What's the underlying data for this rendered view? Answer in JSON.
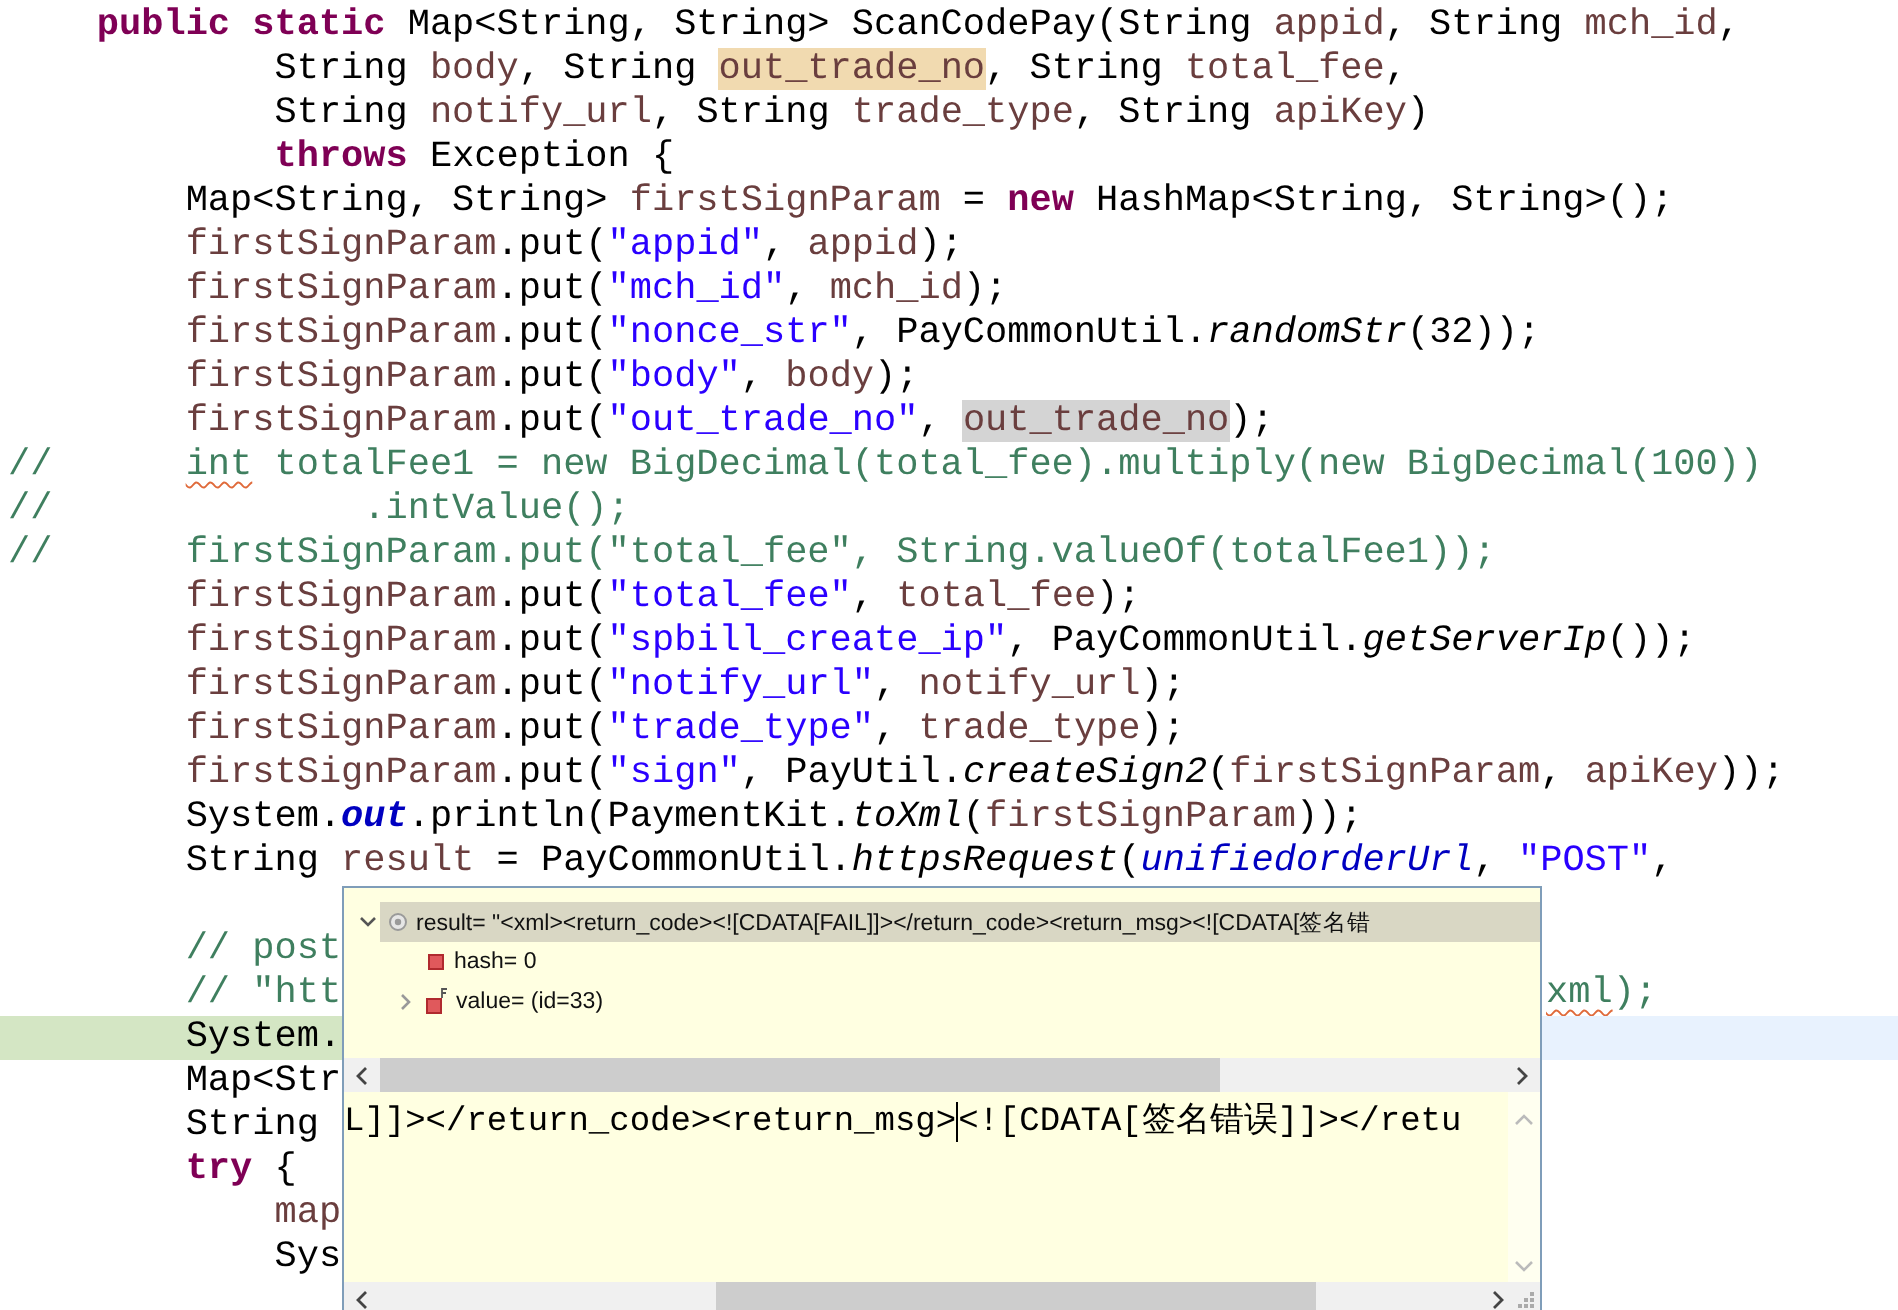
{
  "editor": {
    "lines": [
      {
        "tokens": [
          {
            "kind": "keyword",
            "t": "    public static"
          },
          {
            "kind": "plain",
            "t": " Map<String, String> ScanCodePay(String "
          },
          {
            "kind": "var",
            "t": "appid"
          },
          {
            "kind": "plain",
            "t": ", String "
          },
          {
            "kind": "var",
            "t": "mch_id"
          },
          {
            "kind": "plain",
            "t": ","
          }
        ]
      },
      {
        "tokens": [
          {
            "kind": "plain",
            "t": "            String "
          },
          {
            "kind": "var",
            "t": "body"
          },
          {
            "kind": "plain",
            "t": ", String "
          },
          {
            "kind": "var",
            "t": "out_trade_no",
            "write_occurrence": true
          },
          {
            "kind": "plain",
            "t": ", String "
          },
          {
            "kind": "var",
            "t": "total_fee"
          },
          {
            "kind": "plain",
            "t": ","
          }
        ]
      },
      {
        "tokens": [
          {
            "kind": "plain",
            "t": "            String "
          },
          {
            "kind": "var",
            "t": "notify_url"
          },
          {
            "kind": "plain",
            "t": ", String "
          },
          {
            "kind": "var",
            "t": "trade_type"
          },
          {
            "kind": "plain",
            "t": ", String "
          },
          {
            "kind": "var",
            "t": "apiKey"
          },
          {
            "kind": "plain",
            "t": ")"
          }
        ]
      },
      {
        "tokens": [
          {
            "kind": "keyword",
            "t": "            throws"
          },
          {
            "kind": "plain",
            "t": " Exception {"
          }
        ]
      },
      {
        "tokens": [
          {
            "kind": "plain",
            "t": "        Map<String, String> "
          },
          {
            "kind": "var",
            "t": "firstSignParam"
          },
          {
            "kind": "plain",
            "t": " = "
          },
          {
            "kind": "keyword",
            "t": "new"
          },
          {
            "kind": "plain",
            "t": " HashMap<String, String>();"
          }
        ]
      },
      {
        "tokens": [
          {
            "kind": "var",
            "t": "        firstSignParam"
          },
          {
            "kind": "plain",
            "t": ".put("
          },
          {
            "kind": "string",
            "t": "\"appid\""
          },
          {
            "kind": "plain",
            "t": ", "
          },
          {
            "kind": "var",
            "t": "appid"
          },
          {
            "kind": "plain",
            "t": ");"
          }
        ]
      },
      {
        "tokens": [
          {
            "kind": "var",
            "t": "        firstSignParam"
          },
          {
            "kind": "plain",
            "t": ".put("
          },
          {
            "kind": "string",
            "t": "\"mch_id\""
          },
          {
            "kind": "plain",
            "t": ", "
          },
          {
            "kind": "var",
            "t": "mch_id"
          },
          {
            "kind": "plain",
            "t": ");"
          }
        ]
      },
      {
        "tokens": [
          {
            "kind": "var",
            "t": "        firstSignParam"
          },
          {
            "kind": "plain",
            "t": ".put("
          },
          {
            "kind": "string",
            "t": "\"nonce_str\""
          },
          {
            "kind": "plain",
            "t": ", PayCommonUtil."
          },
          {
            "kind": "static_method",
            "t": "randomStr"
          },
          {
            "kind": "plain",
            "t": "(32));"
          }
        ]
      },
      {
        "tokens": [
          {
            "kind": "var",
            "t": "        firstSignParam"
          },
          {
            "kind": "plain",
            "t": ".put("
          },
          {
            "kind": "string",
            "t": "\"body\""
          },
          {
            "kind": "plain",
            "t": ", "
          },
          {
            "kind": "var",
            "t": "body"
          },
          {
            "kind": "plain",
            "t": ");"
          }
        ]
      },
      {
        "tokens": [
          {
            "kind": "var",
            "t": "        firstSignParam"
          },
          {
            "kind": "plain",
            "t": ".put("
          },
          {
            "kind": "string",
            "t": "\"out_trade_no\""
          },
          {
            "kind": "plain",
            "t": ", "
          },
          {
            "kind": "var",
            "t": "out_trade_no",
            "read_occurrence": true
          },
          {
            "kind": "plain",
            "t": ");"
          }
        ]
      },
      {
        "tokens": [
          {
            "kind": "comment",
            "t": "//      "
          },
          {
            "kind": "comment",
            "t": "int",
            "squiggle": true
          },
          {
            "kind": "comment",
            "t": " totalFee1 = new BigDecimal(total_fee).multiply(new BigDecimal(100))"
          }
        ]
      },
      {
        "tokens": [
          {
            "kind": "comment",
            "t": "//              .intValue();"
          }
        ]
      },
      {
        "tokens": [
          {
            "kind": "comment",
            "t": "//      firstSignParam.put(\"total_fee\", String.valueOf(totalFee1));"
          }
        ]
      },
      {
        "tokens": [
          {
            "kind": "var",
            "t": "        firstSignParam"
          },
          {
            "kind": "plain",
            "t": ".put("
          },
          {
            "kind": "string",
            "t": "\"total_fee\""
          },
          {
            "kind": "plain",
            "t": ", "
          },
          {
            "kind": "var",
            "t": "total_fee"
          },
          {
            "kind": "plain",
            "t": ");"
          }
        ]
      },
      {
        "tokens": [
          {
            "kind": "var",
            "t": "        firstSignParam"
          },
          {
            "kind": "plain",
            "t": ".put("
          },
          {
            "kind": "string",
            "t": "\"spbill_create_ip\""
          },
          {
            "kind": "plain",
            "t": ", PayCommonUtil."
          },
          {
            "kind": "static_method",
            "t": "getServerIp"
          },
          {
            "kind": "plain",
            "t": "());"
          }
        ]
      },
      {
        "tokens": [
          {
            "kind": "var",
            "t": "        firstSignParam"
          },
          {
            "kind": "plain",
            "t": ".put("
          },
          {
            "kind": "string",
            "t": "\"notify_url\""
          },
          {
            "kind": "plain",
            "t": ", "
          },
          {
            "kind": "var",
            "t": "notify_url"
          },
          {
            "kind": "plain",
            "t": ");"
          }
        ]
      },
      {
        "tokens": [
          {
            "kind": "var",
            "t": "        firstSignParam"
          },
          {
            "kind": "plain",
            "t": ".put("
          },
          {
            "kind": "string",
            "t": "\"trade_type\""
          },
          {
            "kind": "plain",
            "t": ", "
          },
          {
            "kind": "var",
            "t": "trade_type"
          },
          {
            "kind": "plain",
            "t": ");"
          }
        ]
      },
      {
        "tokens": [
          {
            "kind": "var",
            "t": "        firstSignParam"
          },
          {
            "kind": "plain",
            "t": ".put("
          },
          {
            "kind": "string",
            "t": "\"sign\""
          },
          {
            "kind": "plain",
            "t": ", PayUtil."
          },
          {
            "kind": "static_method",
            "t": "createSign2"
          },
          {
            "kind": "plain",
            "t": "("
          },
          {
            "kind": "var",
            "t": "firstSignParam"
          },
          {
            "kind": "plain",
            "t": ", "
          },
          {
            "kind": "var",
            "t": "apiKey"
          },
          {
            "kind": "plain",
            "t": "));"
          }
        ]
      },
      {
        "tokens": [
          {
            "kind": "plain",
            "t": "        System."
          },
          {
            "kind": "static_field",
            "t": "out"
          },
          {
            "kind": "plain",
            "t": ".println(PaymentKit."
          },
          {
            "kind": "static_method",
            "t": "toXml"
          },
          {
            "kind": "plain",
            "t": "("
          },
          {
            "kind": "var",
            "t": "firstSignParam"
          },
          {
            "kind": "plain",
            "t": "));"
          }
        ]
      },
      {
        "tokens": [
          {
            "kind": "plain",
            "t": "        String "
          },
          {
            "kind": "var",
            "t": "result"
          },
          {
            "kind": "plain",
            "t": " = PayCommonUtil."
          },
          {
            "kind": "static_method",
            "t": "httpsRequest"
          },
          {
            "kind": "plain",
            "t": "("
          },
          {
            "kind": "constant",
            "t": "unifiedorderUrl"
          },
          {
            "kind": "plain",
            "t": ", "
          },
          {
            "kind": "string",
            "t": "\"POST\""
          },
          {
            "kind": "plain",
            "t": ","
          }
        ]
      },
      {
        "current": false
      },
      {
        "tokens": [
          {
            "kind": "comment",
            "t": "        // post"
          }
        ]
      },
      {
        "tokens": [
          {
            "kind": "comment",
            "t": "        // \"htt"
          }
        ],
        "right": [
          {
            "kind": "comment",
            "t": "xml",
            "squiggle": true
          },
          {
            "kind": "comment",
            "t": ");"
          }
        ]
      },
      {
        "tokens": [
          {
            "kind": "plain",
            "t": "        System."
          }
        ],
        "current": true
      },
      {
        "tokens": [
          {
            "kind": "plain",
            "t": "        Map<Str"
          }
        ]
      },
      {
        "tokens": [
          {
            "kind": "plain",
            "t": "        String"
          }
        ]
      },
      {
        "tokens": [
          {
            "kind": "keyword",
            "t": "        try"
          },
          {
            "kind": "plain",
            "t": " {"
          }
        ]
      },
      {
        "tokens": [
          {
            "kind": "var",
            "t": "            map"
          }
        ]
      },
      {
        "tokens": [
          {
            "kind": "plain",
            "t": "            Sys"
          }
        ]
      }
    ]
  },
  "debug_popup": {
    "tree": [
      {
        "kind": "local",
        "label": "result= \"<xml><return_code><![CDATA[FAIL]]></return_code><return_msg><![CDATA[签名错",
        "expanded": true,
        "selected": true,
        "children": [
          {
            "kind": "field",
            "label": "hash= 0",
            "selected": false
          },
          {
            "kind": "final_field",
            "label": "value= (id=33)",
            "expanded": false,
            "selected": false
          }
        ]
      }
    ],
    "detail": {
      "text_before_caret": "L]]></return_code><return_msg>",
      "text_after_caret": "<![CDATA[签名错误]]></retu"
    }
  }
}
